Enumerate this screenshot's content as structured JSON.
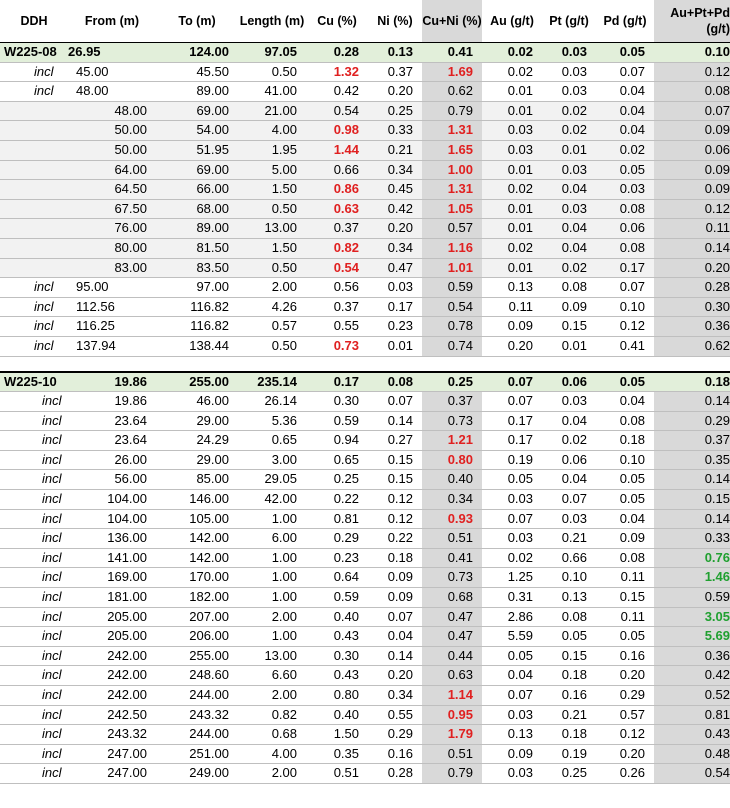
{
  "headers": [
    "DDH",
    "From (m)",
    "To (m)",
    "Length (m)",
    "Cu (%)",
    "Ni (%)",
    "Cu+Ni (%)",
    "Au (g/t)",
    "Pt (g/t)",
    "Pd (g/t)",
    "Au+Pt+Pd (g/t)"
  ],
  "holes": [
    {
      "summary": [
        "W225-08",
        "26.95",
        "124.00",
        "97.05",
        "0.28",
        "0.13",
        "0.41",
        "0.02",
        "0.03",
        "0.05",
        "0.10"
      ],
      "rows": [
        {
          "incl": "incl",
          "from": "45.00",
          "to": "45.50",
          "len": "0.50",
          "cu": "1.32",
          "ni": "0.37",
          "cuni": "1.69",
          "au": "0.02",
          "pt": "0.03",
          "pd": "0.07",
          "sum": "0.12",
          "cu_hi": true,
          "cuni_hi": true,
          "sum_hi": false,
          "indent": 1
        },
        {
          "incl": "incl",
          "from": "48.00",
          "to": "89.00",
          "len": "41.00",
          "cu": "0.42",
          "ni": "0.20",
          "cuni": "0.62",
          "au": "0.01",
          "pt": "0.03",
          "pd": "0.04",
          "sum": "0.08",
          "cu_hi": false,
          "cuni_hi": false,
          "sum_hi": false,
          "indent": 1
        },
        {
          "incl": "",
          "from": "48.00",
          "to": "69.00",
          "len": "21.00",
          "cu": "0.54",
          "ni": "0.25",
          "cuni": "0.79",
          "au": "0.01",
          "pt": "0.02",
          "pd": "0.04",
          "sum": "0.07",
          "cu_hi": false,
          "cuni_hi": false,
          "sum_hi": false,
          "indent": 2
        },
        {
          "incl": "",
          "from": "50.00",
          "to": "54.00",
          "len": "4.00",
          "cu": "0.98",
          "ni": "0.33",
          "cuni": "1.31",
          "au": "0.03",
          "pt": "0.02",
          "pd": "0.04",
          "sum": "0.09",
          "cu_hi": true,
          "cuni_hi": true,
          "sum_hi": false,
          "indent": 2
        },
        {
          "incl": "",
          "from": "50.00",
          "to": "51.95",
          "len": "1.95",
          "cu": "1.44",
          "ni": "0.21",
          "cuni": "1.65",
          "au": "0.03",
          "pt": "0.01",
          "pd": "0.02",
          "sum": "0.06",
          "cu_hi": true,
          "cuni_hi": true,
          "sum_hi": false,
          "indent": 2
        },
        {
          "incl": "",
          "from": "64.00",
          "to": "69.00",
          "len": "5.00",
          "cu": "0.66",
          "ni": "0.34",
          "cuni": "1.00",
          "au": "0.01",
          "pt": "0.03",
          "pd": "0.05",
          "sum": "0.09",
          "cu_hi": false,
          "cuni_hi": true,
          "sum_hi": false,
          "indent": 2
        },
        {
          "incl": "",
          "from": "64.50",
          "to": "66.00",
          "len": "1.50",
          "cu": "0.86",
          "ni": "0.45",
          "cuni": "1.31",
          "au": "0.02",
          "pt": "0.04",
          "pd": "0.03",
          "sum": "0.09",
          "cu_hi": true,
          "cuni_hi": true,
          "sum_hi": false,
          "indent": 2
        },
        {
          "incl": "",
          "from": "67.50",
          "to": "68.00",
          "len": "0.50",
          "cu": "0.63",
          "ni": "0.42",
          "cuni": "1.05",
          "au": "0.01",
          "pt": "0.03",
          "pd": "0.08",
          "sum": "0.12",
          "cu_hi": true,
          "cuni_hi": true,
          "sum_hi": false,
          "indent": 2
        },
        {
          "incl": "",
          "from": "76.00",
          "to": "89.00",
          "len": "13.00",
          "cu": "0.37",
          "ni": "0.20",
          "cuni": "0.57",
          "au": "0.01",
          "pt": "0.04",
          "pd": "0.06",
          "sum": "0.11",
          "cu_hi": false,
          "cuni_hi": false,
          "sum_hi": false,
          "indent": 2
        },
        {
          "incl": "",
          "from": "80.00",
          "to": "81.50",
          "len": "1.50",
          "cu": "0.82",
          "ni": "0.34",
          "cuni": "1.16",
          "au": "0.02",
          "pt": "0.04",
          "pd": "0.08",
          "sum": "0.14",
          "cu_hi": true,
          "cuni_hi": true,
          "sum_hi": false,
          "indent": 2
        },
        {
          "incl": "",
          "from": "83.00",
          "to": "83.50",
          "len": "0.50",
          "cu": "0.54",
          "ni": "0.47",
          "cuni": "1.01",
          "au": "0.01",
          "pt": "0.02",
          "pd": "0.17",
          "sum": "0.20",
          "cu_hi": true,
          "cuni_hi": true,
          "sum_hi": false,
          "indent": 2
        },
        {
          "incl": "incl",
          "from": "95.00",
          "to": "97.00",
          "len": "2.00",
          "cu": "0.56",
          "ni": "0.03",
          "cuni": "0.59",
          "au": "0.13",
          "pt": "0.08",
          "pd": "0.07",
          "sum": "0.28",
          "cu_hi": false,
          "cuni_hi": false,
          "sum_hi": false,
          "indent": 1
        },
        {
          "incl": "incl",
          "from": "112.56",
          "to": "116.82",
          "len": "4.26",
          "cu": "0.37",
          "ni": "0.17",
          "cuni": "0.54",
          "au": "0.11",
          "pt": "0.09",
          "pd": "0.10",
          "sum": "0.30",
          "cu_hi": false,
          "cuni_hi": false,
          "sum_hi": false,
          "indent": 1
        },
        {
          "incl": "incl",
          "from": "116.25",
          "to": "116.82",
          "len": "0.57",
          "cu": "0.55",
          "ni": "0.23",
          "cuni": "0.78",
          "au": "0.09",
          "pt": "0.15",
          "pd": "0.12",
          "sum": "0.36",
          "cu_hi": false,
          "cuni_hi": false,
          "sum_hi": false,
          "indent": 1
        },
        {
          "incl": "incl",
          "from": "137.94",
          "to": "138.44",
          "len": "0.50",
          "cu": "0.73",
          "ni": "0.01",
          "cuni": "0.74",
          "au": "0.20",
          "pt": "0.01",
          "pd": "0.41",
          "sum": "0.62",
          "cu_hi": true,
          "cuni_hi": false,
          "sum_hi": false,
          "indent": 1
        }
      ]
    },
    {
      "summary": [
        "W225-10",
        "19.86",
        "255.00",
        "235.14",
        "0.17",
        "0.08",
        "0.25",
        "0.07",
        "0.06",
        "0.05",
        "0.18"
      ],
      "rows": [
        {
          "incl": "incl",
          "from": "19.86",
          "to": "46.00",
          "len": "26.14",
          "cu": "0.30",
          "ni": "0.07",
          "cuni": "0.37",
          "au": "0.07",
          "pt": "0.03",
          "pd": "0.04",
          "sum": "0.14",
          "cu_hi": false,
          "cuni_hi": false,
          "sum_hi": false,
          "indent": 3
        },
        {
          "incl": "incl",
          "from": "23.64",
          "to": "29.00",
          "len": "5.36",
          "cu": "0.59",
          "ni": "0.14",
          "cuni": "0.73",
          "au": "0.17",
          "pt": "0.04",
          "pd": "0.08",
          "sum": "0.29",
          "cu_hi": false,
          "cuni_hi": false,
          "sum_hi": false,
          "indent": 3
        },
        {
          "incl": "incl",
          "from": "23.64",
          "to": "24.29",
          "len": "0.65",
          "cu": "0.94",
          "ni": "0.27",
          "cuni": "1.21",
          "au": "0.17",
          "pt": "0.02",
          "pd": "0.18",
          "sum": "0.37",
          "cu_hi": false,
          "cuni_hi": true,
          "sum_hi": false,
          "indent": 3
        },
        {
          "incl": "incl",
          "from": "26.00",
          "to": "29.00",
          "len": "3.00",
          "cu": "0.65",
          "ni": "0.15",
          "cuni": "0.80",
          "au": "0.19",
          "pt": "0.06",
          "pd": "0.10",
          "sum": "0.35",
          "cu_hi": false,
          "cuni_hi": true,
          "sum_hi": false,
          "indent": 3
        },
        {
          "incl": "incl",
          "from": "56.00",
          "to": "85.00",
          "len": "29.05",
          "cu": "0.25",
          "ni": "0.15",
          "cuni": "0.40",
          "au": "0.05",
          "pt": "0.04",
          "pd": "0.05",
          "sum": "0.14",
          "cu_hi": false,
          "cuni_hi": false,
          "sum_hi": false,
          "indent": 3
        },
        {
          "incl": "incl",
          "from": "104.00",
          "to": "146.00",
          "len": "42.00",
          "cu": "0.22",
          "ni": "0.12",
          "cuni": "0.34",
          "au": "0.03",
          "pt": "0.07",
          "pd": "0.05",
          "sum": "0.15",
          "cu_hi": false,
          "cuni_hi": false,
          "sum_hi": false,
          "indent": 3
        },
        {
          "incl": "incl",
          "from": "104.00",
          "to": "105.00",
          "len": "1.00",
          "cu": "0.81",
          "ni": "0.12",
          "cuni": "0.93",
          "au": "0.07",
          "pt": "0.03",
          "pd": "0.04",
          "sum": "0.14",
          "cu_hi": false,
          "cuni_hi": true,
          "sum_hi": false,
          "indent": 3
        },
        {
          "incl": "incl",
          "from": "136.00",
          "to": "142.00",
          "len": "6.00",
          "cu": "0.29",
          "ni": "0.22",
          "cuni": "0.51",
          "au": "0.03",
          "pt": "0.21",
          "pd": "0.09",
          "sum": "0.33",
          "cu_hi": false,
          "cuni_hi": false,
          "sum_hi": false,
          "indent": 3
        },
        {
          "incl": "incl",
          "from": "141.00",
          "to": "142.00",
          "len": "1.00",
          "cu": "0.23",
          "ni": "0.18",
          "cuni": "0.41",
          "au": "0.02",
          "pt": "0.66",
          "pd": "0.08",
          "sum": "0.76",
          "cu_hi": false,
          "cuni_hi": false,
          "sum_hi": true,
          "indent": 3
        },
        {
          "incl": "incl",
          "from": "169.00",
          "to": "170.00",
          "len": "1.00",
          "cu": "0.64",
          "ni": "0.09",
          "cuni": "0.73",
          "au": "1.25",
          "pt": "0.10",
          "pd": "0.11",
          "sum": "1.46",
          "cu_hi": false,
          "cuni_hi": false,
          "sum_hi": true,
          "indent": 3
        },
        {
          "incl": "incl",
          "from": "181.00",
          "to": "182.00",
          "len": "1.00",
          "cu": "0.59",
          "ni": "0.09",
          "cuni": "0.68",
          "au": "0.31",
          "pt": "0.13",
          "pd": "0.15",
          "sum": "0.59",
          "cu_hi": false,
          "cuni_hi": false,
          "sum_hi": false,
          "indent": 3
        },
        {
          "incl": "incl",
          "from": "205.00",
          "to": "207.00",
          "len": "2.00",
          "cu": "0.40",
          "ni": "0.07",
          "cuni": "0.47",
          "au": "2.86",
          "pt": "0.08",
          "pd": "0.11",
          "sum": "3.05",
          "cu_hi": false,
          "cuni_hi": false,
          "sum_hi": true,
          "indent": 3
        },
        {
          "incl": "incl",
          "from": "205.00",
          "to": "206.00",
          "len": "1.00",
          "cu": "0.43",
          "ni": "0.04",
          "cuni": "0.47",
          "au": "5.59",
          "pt": "0.05",
          "pd": "0.05",
          "sum": "5.69",
          "cu_hi": false,
          "cuni_hi": false,
          "sum_hi": true,
          "indent": 3
        },
        {
          "incl": "incl",
          "from": "242.00",
          "to": "255.00",
          "len": "13.00",
          "cu": "0.30",
          "ni": "0.14",
          "cuni": "0.44",
          "au": "0.05",
          "pt": "0.15",
          "pd": "0.16",
          "sum": "0.36",
          "cu_hi": false,
          "cuni_hi": false,
          "sum_hi": false,
          "indent": 3
        },
        {
          "incl": "incl",
          "from": "242.00",
          "to": "248.60",
          "len": "6.60",
          "cu": "0.43",
          "ni": "0.20",
          "cuni": "0.63",
          "au": "0.04",
          "pt": "0.18",
          "pd": "0.20",
          "sum": "0.42",
          "cu_hi": false,
          "cuni_hi": false,
          "sum_hi": false,
          "indent": 3
        },
        {
          "incl": "incl",
          "from": "242.00",
          "to": "244.00",
          "len": "2.00",
          "cu": "0.80",
          "ni": "0.34",
          "cuni": "1.14",
          "au": "0.07",
          "pt": "0.16",
          "pd": "0.29",
          "sum": "0.52",
          "cu_hi": false,
          "cuni_hi": true,
          "sum_hi": false,
          "indent": 3
        },
        {
          "incl": "incl",
          "from": "242.50",
          "to": "243.32",
          "len": "0.82",
          "cu": "0.40",
          "ni": "0.55",
          "cuni": "0.95",
          "au": "0.03",
          "pt": "0.21",
          "pd": "0.57",
          "sum": "0.81",
          "cu_hi": false,
          "cuni_hi": true,
          "sum_hi": false,
          "indent": 3
        },
        {
          "incl": "incl",
          "from": "243.32",
          "to": "244.00",
          "len": "0.68",
          "cu": "1.50",
          "ni": "0.29",
          "cuni": "1.79",
          "au": "0.13",
          "pt": "0.18",
          "pd": "0.12",
          "sum": "0.43",
          "cu_hi": false,
          "cuni_hi": true,
          "sum_hi": false,
          "indent": 3
        },
        {
          "incl": "incl",
          "from": "247.00",
          "to": "251.00",
          "len": "4.00",
          "cu": "0.35",
          "ni": "0.16",
          "cuni": "0.51",
          "au": "0.09",
          "pt": "0.19",
          "pd": "0.20",
          "sum": "0.48",
          "cu_hi": false,
          "cuni_hi": false,
          "sum_hi": false,
          "indent": 3
        },
        {
          "incl": "incl",
          "from": "247.00",
          "to": "249.00",
          "len": "2.00",
          "cu": "0.51",
          "ni": "0.28",
          "cuni": "0.79",
          "au": "0.03",
          "pt": "0.25",
          "pd": "0.26",
          "sum": "0.54",
          "cu_hi": false,
          "cuni_hi": false,
          "sum_hi": false,
          "indent": 3
        }
      ]
    }
  ],
  "colors": {
    "highlight_red": "#e02020",
    "highlight_green": "#20a030",
    "summary_bg": "#e2efda",
    "shade_col": "#d9d9d9"
  }
}
